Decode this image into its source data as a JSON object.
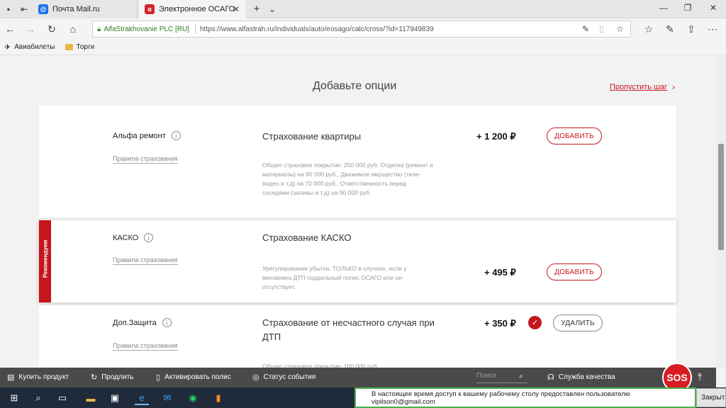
{
  "browser": {
    "tabs": [
      {
        "label": "Почта Mail.ru",
        "favicon": "@"
      },
      {
        "label": "Электронное ОСАГО",
        "favicon": "α"
      }
    ],
    "address": {
      "site_id": "AlfaStrakhovanie PLC [RU]",
      "url": "https://www.alfastrah.ru/individuals/auto/eosago/calc/cross/?id=117949839"
    },
    "favorites": [
      {
        "label": "Авиабилеты",
        "icon": "plane-icon"
      },
      {
        "label": "Торги",
        "icon": "folder-icon"
      }
    ]
  },
  "page": {
    "heading": "Добавьте опции",
    "skip_label": "Пропустить шаг",
    "options": [
      {
        "product": "Альфа ремонт",
        "rules": "Правила страхования",
        "coverage_title": "Страхование квартиры",
        "description": "Общее страховое покрытие: 250 000 руб. Отделка (ремонт и материалы) на 90 000 руб., Движимое имущество (теле-видео и т.д) на 70 000 руб., Ответственность перед соседями (заливы и т.д) на 90 000 руб.",
        "price": "+ 1 200 ₽",
        "button": "ДОБАВИТЬ"
      },
      {
        "product": "КАСКО",
        "badge": "Рекомендуем",
        "rules": "Правила страхования",
        "coverage_title": "Страхование КАСКО",
        "description": "Урегулирование убытка: ТОЛЬКО в случаях, если у виновника ДТП поддельный полис ОСАГО или он отсутствует.",
        "price": "+ 495 ₽",
        "button": "ДОБАВИТЬ"
      },
      {
        "product": "Доп.Защита",
        "rules": "Правила страхования",
        "coverage_title": "Страхование от несчастного случая при ДТП",
        "description": "Общее страховое покрытие: 100 000 руб.",
        "price": "+ 350 ₽",
        "button": "УДАЛИТЬ",
        "selected": true
      }
    ]
  },
  "sitebar": {
    "items": [
      "Купить продукт",
      "Продлить",
      "Активировать полис",
      "Статус события"
    ],
    "search_placeholder": "Поиск",
    "quality": "Служба качества",
    "sos": "SOS"
  },
  "notification": {
    "text": "В настоящее время доступ к вашему рабочему столу предоставлен пользователю vipilson0@gmail.com",
    "close": "Закрыть"
  },
  "colors": {
    "accent": "#c4161c",
    "taskbar": "#1f2a3a"
  }
}
